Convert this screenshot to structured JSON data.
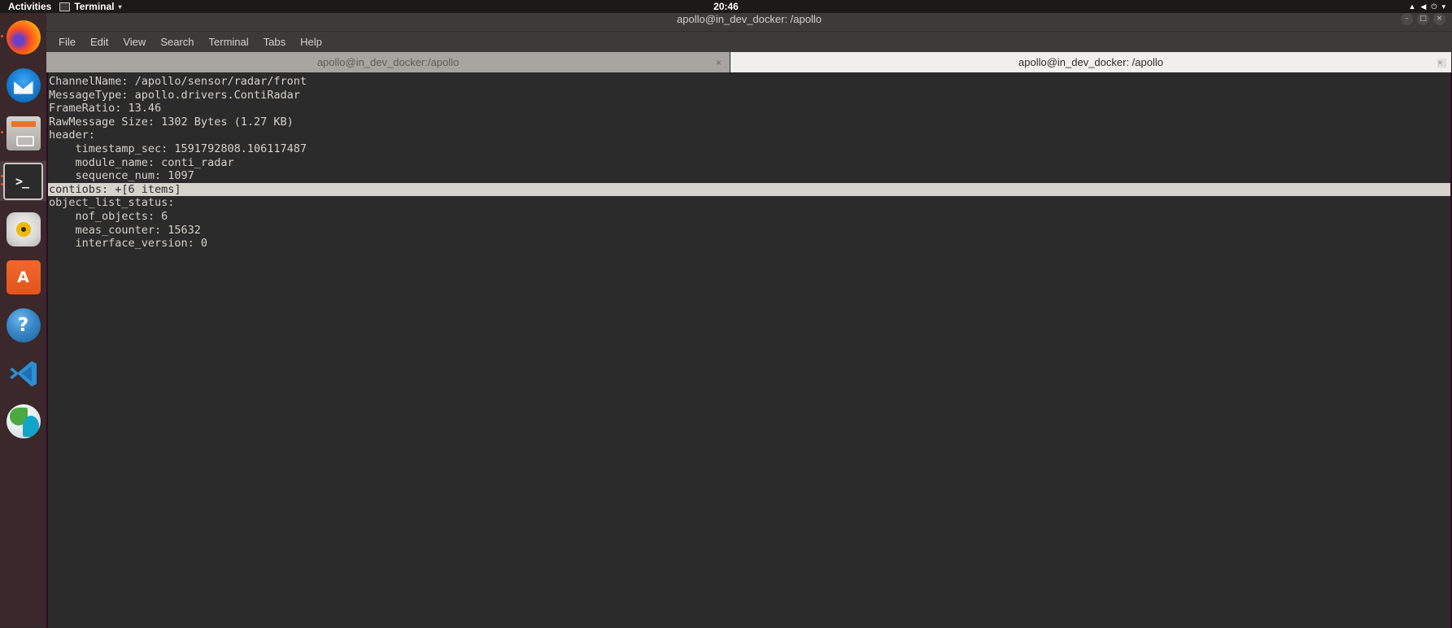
{
  "topbar": {
    "activities": "Activities",
    "app_name": "Terminal",
    "app_menu_caret": "▾",
    "clock": "20:46",
    "terminal_icon": "terminal-window-icon",
    "tray": [
      "network-icon",
      "volume-icon",
      "power-icon",
      "chevron-down-icon"
    ]
  },
  "dock": {
    "items": [
      {
        "name": "firefox",
        "label": "Firefox",
        "running": true,
        "active": false
      },
      {
        "name": "thunderbird",
        "label": "Thunderbird Mail",
        "running": false,
        "active": false
      },
      {
        "name": "files",
        "label": "Files",
        "running": true,
        "active": false
      },
      {
        "name": "terminal",
        "label": "Terminal",
        "running": true,
        "active": true,
        "glyph": ">_"
      },
      {
        "name": "rhythmbox",
        "label": "Rhythmbox",
        "running": false,
        "active": false
      },
      {
        "name": "software",
        "label": "Ubuntu Software",
        "running": false,
        "active": false,
        "glyph": "A"
      },
      {
        "name": "help",
        "label": "Help",
        "running": false,
        "active": false,
        "glyph": "?"
      },
      {
        "name": "vscode",
        "label": "Visual Studio Code",
        "running": false,
        "active": false
      },
      {
        "name": "sphere-app",
        "label": "CloudCompare",
        "running": false,
        "active": false
      }
    ]
  },
  "window": {
    "title": "apollo@in_dev_docker: /apollo",
    "controls": {
      "minimize": "–",
      "maximize": "□",
      "close": "×"
    }
  },
  "menubar": {
    "items": [
      "File",
      "Edit",
      "View",
      "Search",
      "Terminal",
      "Tabs",
      "Help"
    ]
  },
  "tabs": [
    {
      "label": "apollo@in_dev_docker:/apollo",
      "active": false,
      "close": "×"
    },
    {
      "label": "apollo@in_dev_docker: /apollo",
      "active": true,
      "close": "×"
    }
  ],
  "tabbar": {
    "new_tab": "▤"
  },
  "terminal": {
    "lines": [
      {
        "text": "ChannelName: /apollo/sensor/radar/front",
        "highlight": false
      },
      {
        "text": "MessageType: apollo.drivers.ContiRadar",
        "highlight": false
      },
      {
        "text": "FrameRatio: 13.46",
        "highlight": false
      },
      {
        "text": "RawMessage Size: 1302 Bytes (1.27 KB)",
        "highlight": false
      },
      {
        "text": "header:",
        "highlight": false
      },
      {
        "text": "    timestamp_sec: 1591792808.106117487",
        "highlight": false
      },
      {
        "text": "    module_name: conti_radar",
        "highlight": false
      },
      {
        "text": "    sequence_num: 1097",
        "highlight": false
      },
      {
        "text": "contiobs: +[6 items]",
        "highlight": true
      },
      {
        "text": "object_list_status:",
        "highlight": false
      },
      {
        "text": "    nof_objects: 6",
        "highlight": false
      },
      {
        "text": "    meas_counter: 15632",
        "highlight": false
      },
      {
        "text": "    interface_version: 0",
        "highlight": false
      }
    ]
  },
  "colors": {
    "terminal_bg": "#2b2b2b",
    "terminal_fg": "#d6d2cc",
    "titlebar_bg": "#3c3b37",
    "tab_active_bg": "#f0efed",
    "tab_inactive_bg": "#a8a49f",
    "dock_bg": "#3c282b",
    "accent": "#e95420"
  }
}
